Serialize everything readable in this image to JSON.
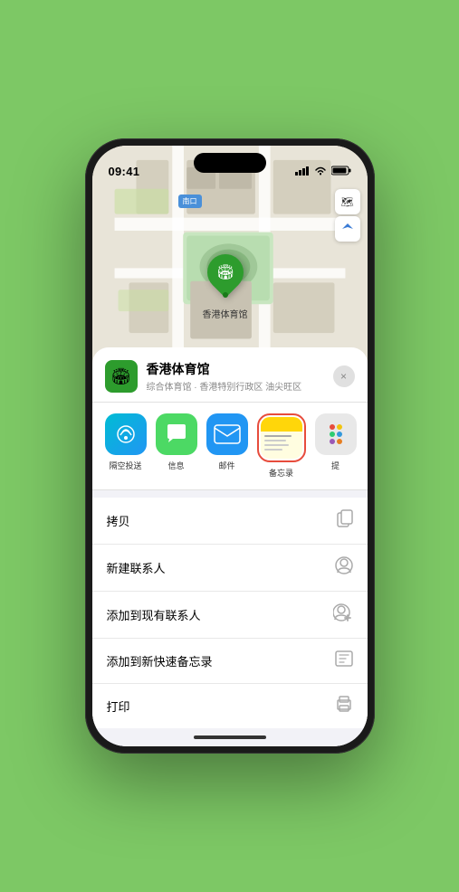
{
  "phone": {
    "status_bar": {
      "time": "09:41",
      "signal_icon": "▋▋▋",
      "wifi_icon": "WiFi",
      "battery_icon": "🔋"
    },
    "map": {
      "south_entrance_label": "南口",
      "marker_label": "香港体育馆",
      "map_btn_1": "🗺",
      "map_btn_2": "↗"
    },
    "sheet": {
      "venue_name": "香港体育馆",
      "venue_desc": "综合体育馆 · 香港特别行政区 油尖旺区",
      "close_label": "×",
      "share_items": [
        {
          "id": "airdrop",
          "label": "隔空投送",
          "type": "airdrop"
        },
        {
          "id": "messages",
          "label": "信息",
          "type": "messages"
        },
        {
          "id": "mail",
          "label": "邮件",
          "type": "mail"
        },
        {
          "id": "notes",
          "label": "备忘录",
          "type": "notes"
        },
        {
          "id": "more",
          "label": "提",
          "type": "more"
        }
      ],
      "action_items": [
        {
          "label": "拷贝",
          "icon": "copy"
        },
        {
          "label": "新建联系人",
          "icon": "person"
        },
        {
          "label": "添加到现有联系人",
          "icon": "person-add"
        },
        {
          "label": "添加到新快速备忘录",
          "icon": "note"
        },
        {
          "label": "打印",
          "icon": "print"
        }
      ]
    }
  }
}
